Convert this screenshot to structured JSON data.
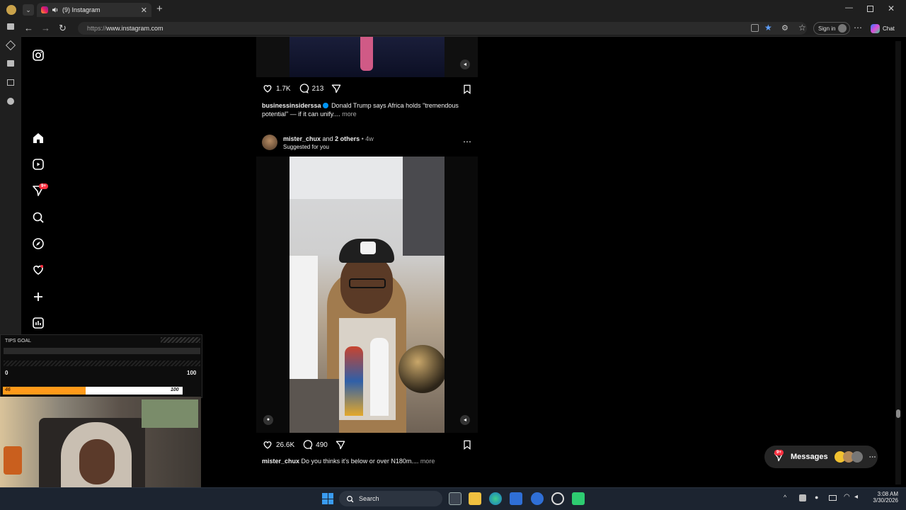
{
  "browser": {
    "tab_title": "(9) Instagram",
    "url_scheme": "https://",
    "url_host": "www.instagram.com",
    "sign_in_label": "Sign in",
    "chat_label": "Chat"
  },
  "sidebar": {
    "notifications_badge": "9+"
  },
  "post1": {
    "likes": "1.7K",
    "comments": "213",
    "author": "businessinsiderssa",
    "caption": "Donald Trump says Africa holds \"tremendous potential\" — if it can unify....",
    "more_label": "more"
  },
  "post2": {
    "author": "mister_chux",
    "collab_text": "and",
    "others": "2 others",
    "time": "• 4w",
    "suggested": "Suggested for you",
    "likes": "26.6K",
    "comments": "490",
    "caption_author": "mister_chux",
    "caption": "Do you thinks it's below or over N180m....",
    "more_label": "more"
  },
  "overlay": {
    "tips_goal_label": "TIPS GOAL",
    "goal_min": "0",
    "goal_max": "100",
    "progress_value": "46",
    "progress_max": "100",
    "progress_fraction": 0.46
  },
  "messages": {
    "label": "Messages",
    "badge": "9+"
  },
  "taskbar": {
    "search_label": "Search",
    "time": "3:08 AM",
    "date": "3/30/2026"
  },
  "colors": {
    "accent_badge": "#ff3040",
    "progress_fill": "#ff9a1a",
    "verified": "#0095f6"
  }
}
